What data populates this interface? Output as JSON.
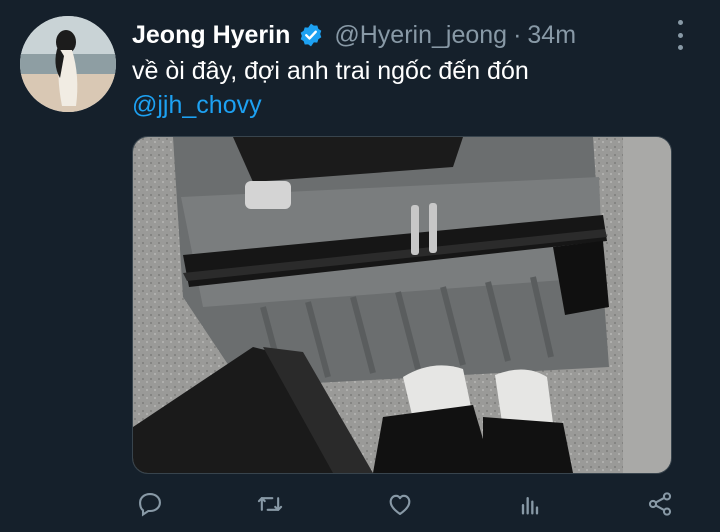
{
  "tweet": {
    "author_name": "Jeong Hyerin",
    "author_handle": "@Hyerin_jeong",
    "separator": "·",
    "time_ago": "34m",
    "text": "về òi đây, đợi anh trai ngốc đến đón",
    "mention": "@jjh_chovy"
  },
  "icons": {
    "verified": "verified-badge-icon",
    "more": "more-options-icon",
    "reply": "reply-icon",
    "retweet": "retweet-icon",
    "like": "like-icon",
    "analytics": "analytics-icon",
    "share": "share-icon"
  },
  "colors": {
    "background": "#15202b",
    "accent": "#1da1f2",
    "muted": "#8899a6"
  }
}
